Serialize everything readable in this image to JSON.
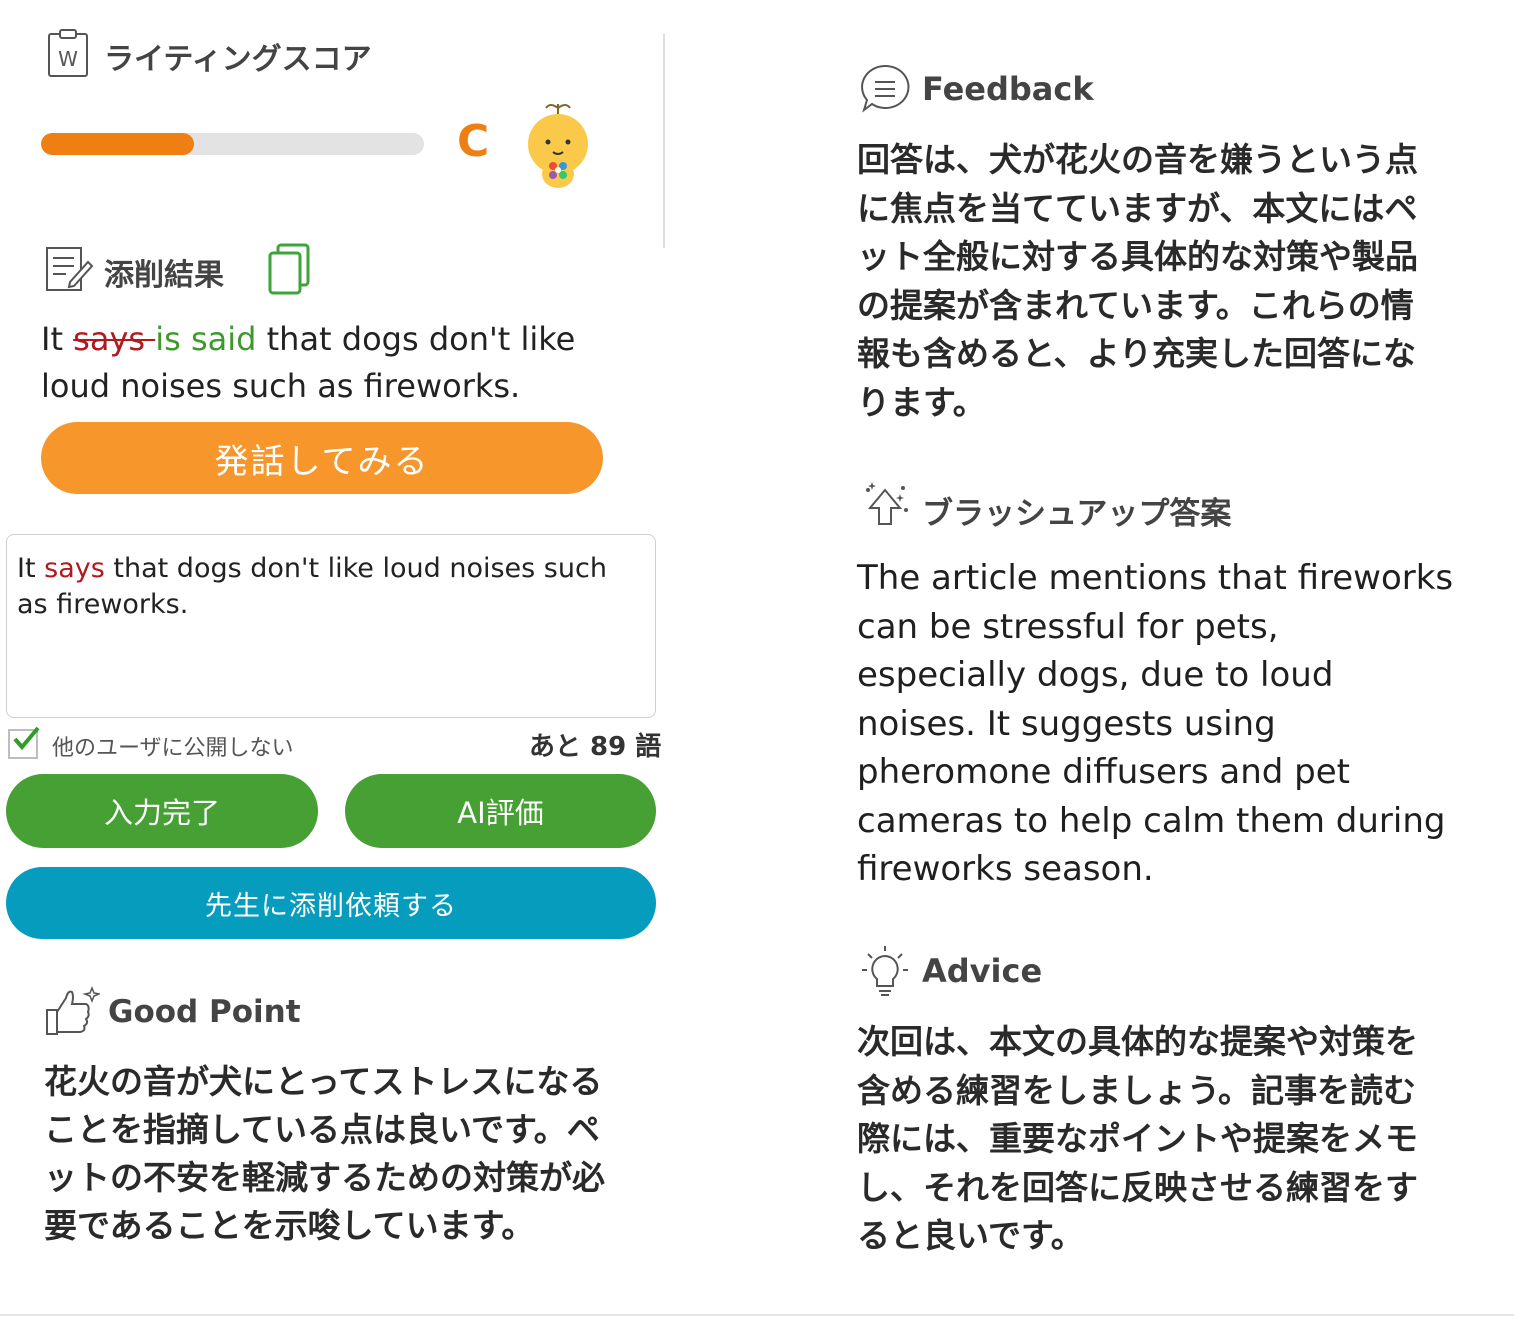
{
  "score": {
    "title": "ライティングスコア",
    "grade": "C",
    "progress_fraction": 0.4,
    "colors": {
      "fill": "#ef7f12",
      "track": "#e3e3e3"
    }
  },
  "correction": {
    "title": "添削結果",
    "sentence": {
      "prefix": "It ",
      "removed": "says ",
      "added": "is said",
      "rest": "  that dogs don't like loud noises such as fireworks."
    }
  },
  "speak_button": {
    "label": "発話してみる",
    "color": "#f7962a"
  },
  "answer": {
    "prefix": "It ",
    "error_word": "says",
    "rest": " that dogs don't like loud noises such as fireworks."
  },
  "private_option": {
    "label": "他のユーザに公開しない",
    "checked": true
  },
  "words_left": "あと 89 語",
  "buttons": {
    "submit": "入力完了",
    "ai_eval": "AI評価",
    "teacher_request": "先生に添削依頼する"
  },
  "good_point": {
    "title": "Good Point",
    "body": "花火の音が犬にとってストレスになることを指摘している点は良いです。ペットの不安を軽減するための対策が必要であることを示唆しています。"
  },
  "feedback": {
    "title": "Feedback",
    "body": "回答は、犬が花火の音を嫌うという点に焦点を当てていますが、本文にはペット全般に対する具体的な対策や製品の提案が含まれています。これらの情報も含めると、より充実した回答になります。"
  },
  "brushup": {
    "title": "ブラッシュアップ答案",
    "body": "The article mentions that fireworks can be stressful for pets, especially dogs, due to loud noises. It suggests using pheromone diffusers and pet cameras to help calm them during fireworks season."
  },
  "advice": {
    "title": "Advice",
    "body": "次回は、本文の具体的な提案や対策を含める練習をしましょう。記事を読む際には、重要なポイントや提案をメモし、それを回答に反映させる練習をすると良いです。"
  },
  "icons": {
    "score": "writing-score-icon",
    "mascot": "mascot-character-icon",
    "correction": "correction-note-icon",
    "copy": "copy-icon",
    "checkbox": "checkmark-icon",
    "good_point": "thumbs-up-icon",
    "feedback": "speech-bubble-icon",
    "brushup": "brushup-arrow-icon",
    "advice": "lightbulb-icon"
  },
  "colors": {
    "green_button": "#46a033",
    "blue_button": "#069cbd",
    "error_red": "#b0191e",
    "added_green": "#3c9a2c"
  }
}
